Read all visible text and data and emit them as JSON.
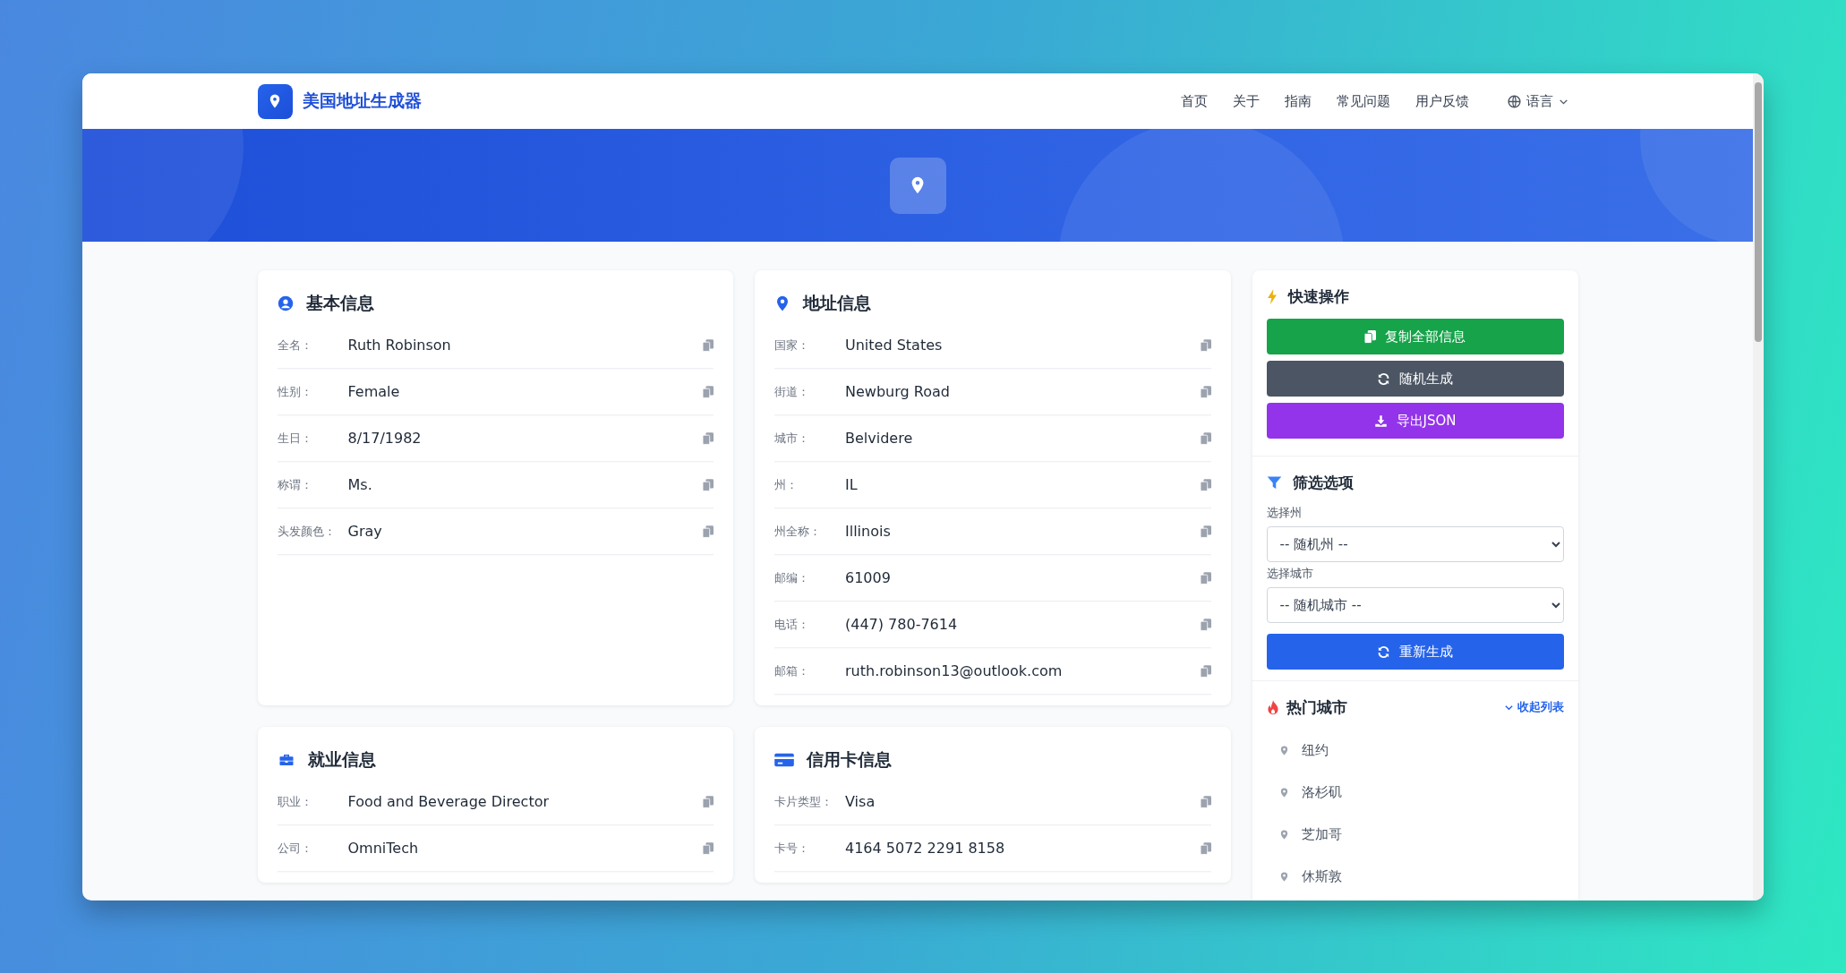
{
  "header": {
    "logo_text": "美国地址生成器",
    "nav": [
      {
        "label": "首页"
      },
      {
        "label": "关于"
      },
      {
        "label": "指南"
      },
      {
        "label": "常见问题"
      },
      {
        "label": "用户反馈"
      }
    ],
    "language": "语言"
  },
  "cards": [
    {
      "title": "基本信息",
      "kind": "person",
      "fields": [
        {
          "label": "全名：",
          "value": "Ruth Robinson"
        },
        {
          "label": "性别：",
          "value": "Female"
        },
        {
          "label": "生日：",
          "value": "8/17/1982"
        },
        {
          "label": "称谓：",
          "value": "Ms."
        },
        {
          "label": "头发颜色：",
          "value": "Gray"
        }
      ]
    },
    {
      "title": "地址信息",
      "kind": "address",
      "fields": [
        {
          "label": "国家：",
          "value": "United States"
        },
        {
          "label": "街道：",
          "value": "Newburg Road"
        },
        {
          "label": "城市：",
          "value": "Belvidere"
        },
        {
          "label": "州：",
          "value": "IL"
        },
        {
          "label": "州全称：",
          "value": "Illinois"
        },
        {
          "label": "邮编：",
          "value": "61009"
        },
        {
          "label": "电话：",
          "value": "(447) 780-7614"
        },
        {
          "label": "邮箱：",
          "value": "ruth.robinson13@outlook.com"
        }
      ]
    },
    {
      "title": "就业信息",
      "kind": "employment",
      "fields": [
        {
          "label": "职业：",
          "value": "Food and Beverage Director"
        },
        {
          "label": "公司：",
          "value": "OmniTech"
        }
      ]
    },
    {
      "title": "信用卡信息",
      "kind": "credit_card",
      "fields": [
        {
          "label": "卡片类型：",
          "value": "Visa"
        },
        {
          "label": "卡号：",
          "value": "4164 5072 2291 8158"
        }
      ]
    }
  ],
  "sidebar": {
    "quick_actions": {
      "title": "快速操作",
      "buttons": [
        {
          "label": "复制全部信息",
          "kind": "copy"
        },
        {
          "label": "随机生成",
          "kind": "random"
        },
        {
          "label": "导出JSON",
          "kind": "export"
        }
      ]
    },
    "filters": {
      "title": "筛选选项",
      "selects": [
        {
          "label": "选择州",
          "value": "-- 随机州 --"
        },
        {
          "label": "选择城市",
          "value": "-- 随机城市 --"
        }
      ],
      "button": "重新生成"
    },
    "popular_cities": {
      "title": "热门城市",
      "toggle": "收起列表",
      "cities": [
        "纽约",
        "洛杉矶",
        "芝加哥",
        "休斯敦"
      ]
    }
  }
}
